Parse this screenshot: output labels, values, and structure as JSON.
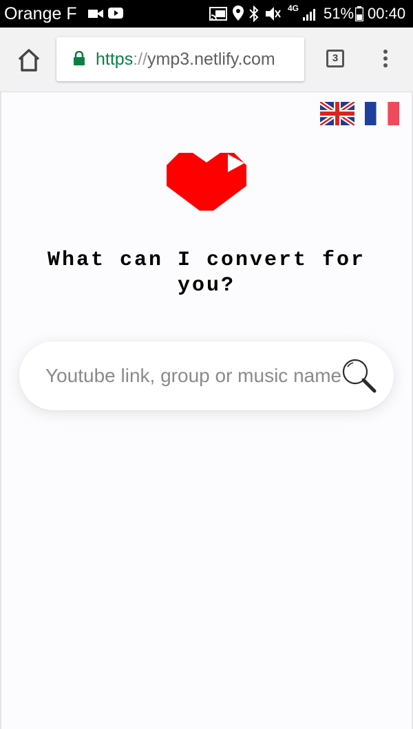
{
  "status_bar": {
    "carrier": "Orange F",
    "network": "4G",
    "battery": "51%",
    "time": "00:40",
    "icons": [
      "video-icon",
      "youtube-icon",
      "cast-icon",
      "location-icon",
      "bluetooth-icon",
      "mute-icon",
      "signal-icon",
      "battery-icon"
    ]
  },
  "browser": {
    "url_scheme": "https",
    "url_separator": "://",
    "url_host": "ymp3.netlify.com",
    "tab_count": "3",
    "icons": [
      "home-icon",
      "lock-icon",
      "tabs-icon",
      "menu-icon"
    ]
  },
  "page": {
    "languages": [
      "English",
      "Français"
    ],
    "heading": "What can I convert for you?",
    "search": {
      "placeholder": "Youtube link, group or music name",
      "value": ""
    },
    "colors": {
      "logo": "#ff0000",
      "url_scheme": "#0b8043",
      "background": "#fcfcff"
    }
  }
}
